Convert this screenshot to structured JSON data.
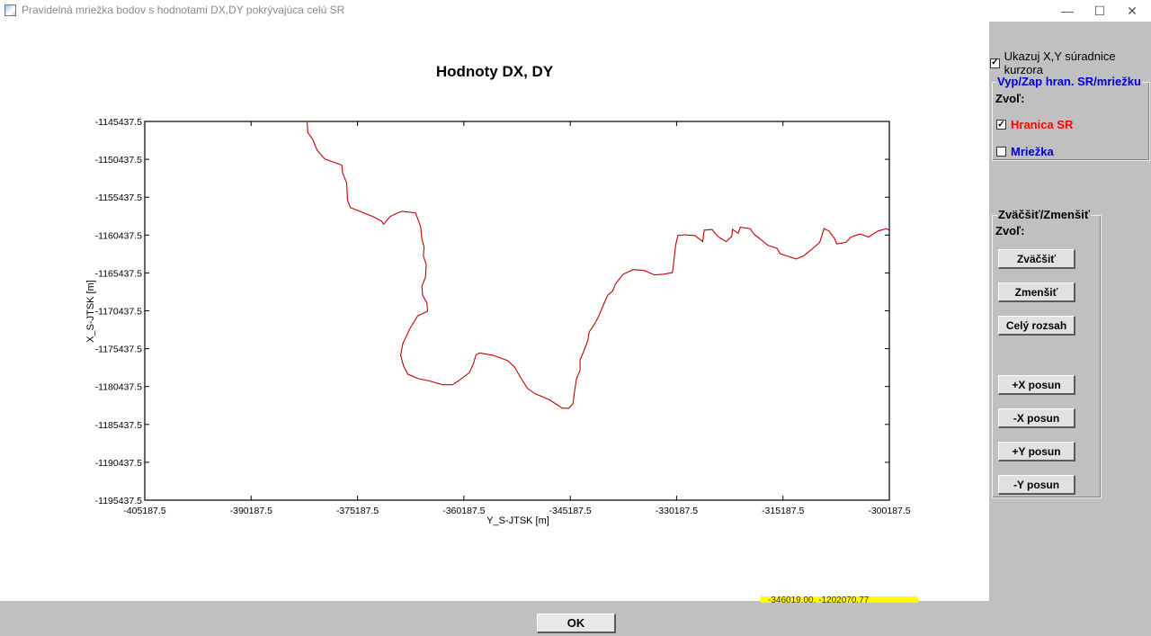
{
  "window": {
    "title": "Pravidelná mriežka bodov s hodnotami DX,DY pokrývajúca celú SR",
    "minimize_glyph": "—",
    "maximize_glyph": "☐",
    "close_glyph": "✕"
  },
  "chart_data": {
    "type": "line",
    "title": "Hodnoty DX, DY",
    "xlabel": "Y_S-JTSK [m]",
    "ylabel": "X_S-JTSK [m]",
    "xlim": [
      -405187.5,
      -300187.5
    ],
    "ylim": [
      -1195437.5,
      -1145437.5
    ],
    "x_ticks": [
      "-405187.5",
      "-390187.5",
      "-375187.5",
      "-360187.5",
      "-345187.5",
      "-330187.5",
      "-315187.5",
      "-300187.5"
    ],
    "y_ticks": [
      "-1145437.5",
      "-1150437.5",
      "-1155437.5",
      "-1160437.5",
      "-1165437.5",
      "-1170437.5",
      "-1175437.5",
      "-1180437.5",
      "-1185437.5",
      "-1190437.5",
      "-1195437.5"
    ],
    "line_color": "#c00000",
    "series": [
      {
        "x": [
          -382300,
          -382200,
          -381500,
          -380900,
          -379800,
          -378300,
          -377400,
          -377300,
          -376700,
          -376600,
          -376200,
          -374600,
          -373000,
          -371800,
          -371500,
          -370600,
          -369500,
          -368900,
          -367000,
          -366300,
          -366100,
          -365800,
          -365900,
          -365500,
          -365600,
          -366100,
          -366000,
          -365400,
          -365300,
          -366700,
          -367800,
          -368800,
          -369100,
          -368700,
          -368100,
          -366600,
          -365000,
          -363200,
          -361800,
          -360800,
          -359400,
          -358800,
          -358500,
          -358000,
          -356100,
          -354000,
          -353000,
          -352300,
          -351200,
          -350100,
          -348100,
          -346300,
          -345400,
          -344800,
          -344600,
          -344300,
          -343800,
          -343800,
          -343200,
          -342700,
          -342500,
          -341900,
          -341300,
          -340300,
          -339900,
          -339200,
          -338800,
          -337700,
          -336300,
          -334800,
          -333300,
          -332000,
          -330800,
          -330700,
          -330500,
          -330300,
          -330000,
          -329000,
          -327600,
          -326500,
          -326300,
          -325200,
          -324400,
          -323200,
          -322400,
          -322300,
          -321500,
          -321200,
          -319800,
          -319300,
          -318600,
          -317300,
          -316000,
          -315600,
          -314600,
          -313300,
          -312300,
          -311100,
          -310000,
          -309400,
          -308700,
          -307900,
          -307600,
          -306300,
          -305600,
          -304300,
          -303100,
          -301800,
          -300600,
          -300187.5
        ],
        "y": [
          -1145437.5,
          -1146900,
          -1147800,
          -1149200,
          -1150400,
          -1150900,
          -1151200,
          -1152200,
          -1153600,
          -1155800,
          -1156800,
          -1157400,
          -1158000,
          -1158600,
          -1159000,
          -1158000,
          -1157500,
          -1157300,
          -1157500,
          -1159300,
          -1161000,
          -1162000,
          -1163200,
          -1164300,
          -1166000,
          -1167200,
          -1168400,
          -1169400,
          -1170500,
          -1171100,
          -1172800,
          -1174800,
          -1176300,
          -1177700,
          -1178800,
          -1179400,
          -1179700,
          -1180200,
          -1180200,
          -1179600,
          -1178600,
          -1177300,
          -1176300,
          -1176000,
          -1176300,
          -1177000,
          -1177900,
          -1179100,
          -1180700,
          -1181400,
          -1182200,
          -1183300,
          -1183300,
          -1182700,
          -1181200,
          -1179400,
          -1178300,
          -1176900,
          -1175600,
          -1174300,
          -1173200,
          -1172400,
          -1171400,
          -1169200,
          -1168400,
          -1167800,
          -1166900,
          -1165600,
          -1165000,
          -1165100,
          -1165700,
          -1165600,
          -1165400,
          -1164900,
          -1163200,
          -1161700,
          -1160500,
          -1160400,
          -1160500,
          -1161300,
          -1159800,
          -1159700,
          -1160600,
          -1161300,
          -1160600,
          -1159700,
          -1160200,
          -1159400,
          -1159600,
          -1160300,
          -1160800,
          -1161800,
          -1162200,
          -1162900,
          -1163200,
          -1163600,
          -1163200,
          -1162300,
          -1161400,
          -1159600,
          -1159900,
          -1160900,
          -1161600,
          -1161400,
          -1160700,
          -1160300,
          -1160700,
          -1159900,
          -1159600,
          -1159800
        ]
      }
    ]
  },
  "panel": {
    "show_cursor_label": "Ukazuj X,Y súradnice kurzora",
    "show_cursor_checked": "✓",
    "boundary_group_title": "Vyp/Zap hran. SR/mriežku",
    "choose_label_1": "Zvoľ:",
    "hranica_label": "Hranica SR",
    "hranica_checked": "✓",
    "hranica_color": "#ff0000",
    "mriezka_label": "Mriežka",
    "mriezka_checked": "",
    "mriezka_color": "#0000cc",
    "zoom_group_title": "Zväčšiť/Zmenšiť",
    "choose_label_2": "Zvoľ:",
    "buttons": {
      "zoom_in": "Zväčšiť",
      "zoom_out": "Zmenšiť",
      "full_range": "Celý rozsah",
      "plus_x": "+X posun",
      "minus_x": "-X posun",
      "plus_y": "+Y posun",
      "minus_y": "-Y posun"
    }
  },
  "footer": {
    "ok_label": "OK",
    "cursor_readout": "-346019.00, -1202070.77"
  }
}
